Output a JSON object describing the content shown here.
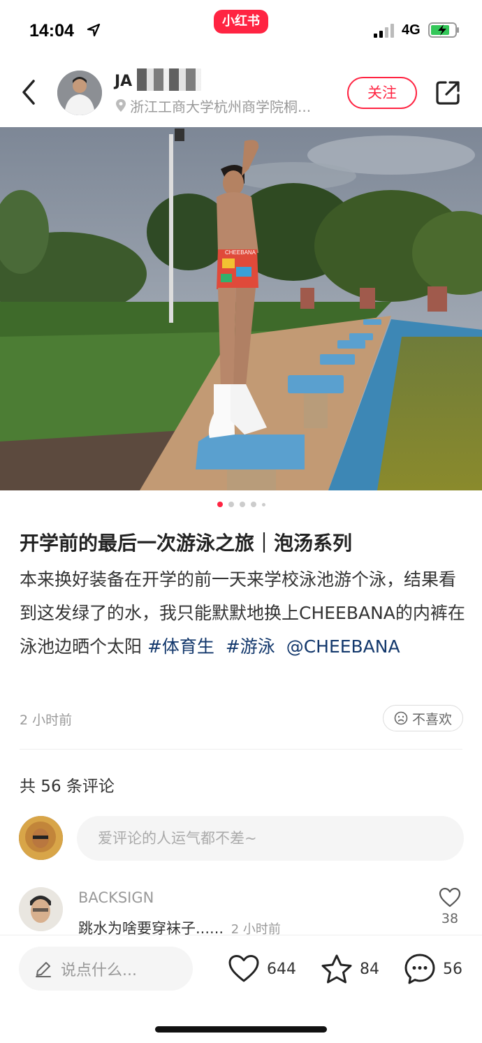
{
  "status_bar": {
    "time": "14:04",
    "brand": "小红书",
    "network": "4G",
    "icons": [
      "location-arrow-icon",
      "signal-icon",
      "battery-charging-icon"
    ]
  },
  "header": {
    "author_name": "JA",
    "location": "浙江工商大学杭州商学院桐...",
    "follow_label": "关注",
    "icons": [
      "back-arrow-icon",
      "pin-icon",
      "share-icon"
    ]
  },
  "carousel": {
    "count": 5,
    "active_index": 0
  },
  "post": {
    "title": "开学前的最后一次游泳之旅｜泡汤系列",
    "body": "本来换好装备在开学的前一天来学校泳池游个泳，结果看到这发绿了的水，我只能默默地换上CHEEBANA的内裤在泳池边晒个太阳",
    "tags": [
      "#体育生",
      "#游泳",
      "@CHEEBANA"
    ],
    "time": "2 小时前",
    "dislike_label": "不喜欢",
    "swimsuit_text": "CHEEBANA"
  },
  "comments": {
    "count_label": "共 56 条评论",
    "input_placeholder": "爱评论的人运气都不差~",
    "items": [
      {
        "user": "BACKSIGN",
        "text": "跳水为啥要穿袜子......",
        "time": "2 小时前",
        "likes": "38"
      }
    ]
  },
  "bottom_bar": {
    "say_placeholder": "说点什么...",
    "likes": "644",
    "collects": "84",
    "comments": "56",
    "icons": [
      "pencil-icon",
      "heart-icon",
      "star-icon",
      "comment-bubble-icon"
    ]
  },
  "colors": {
    "brand_red": "#ff2442",
    "tag_blue": "#13386c"
  }
}
